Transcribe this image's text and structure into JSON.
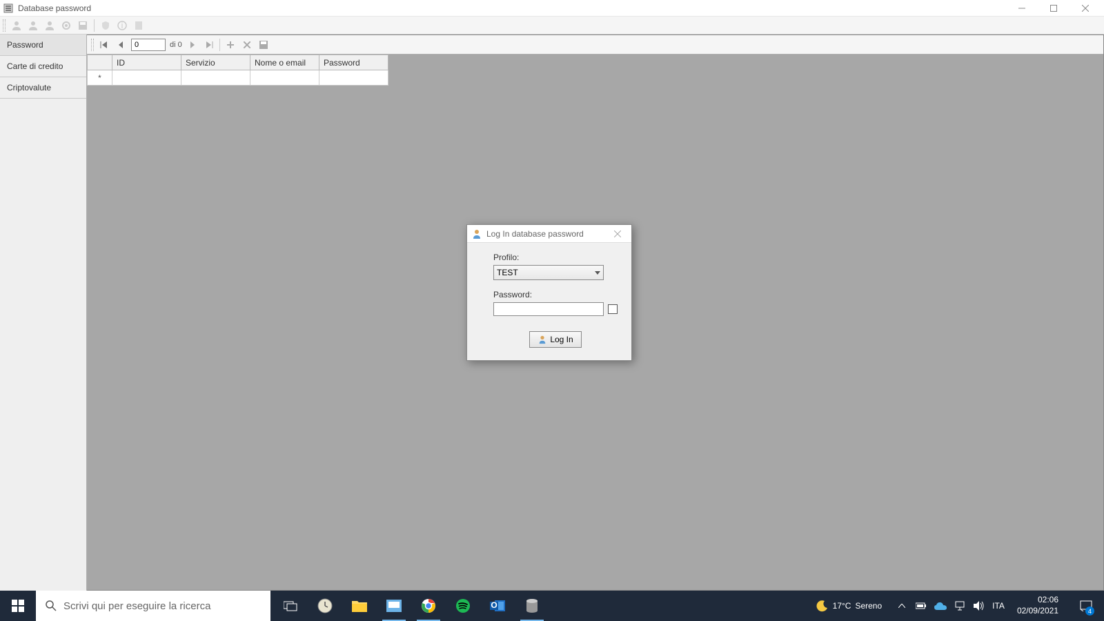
{
  "window": {
    "title": "Database password"
  },
  "sidebar": {
    "items": [
      {
        "label": "Password"
      },
      {
        "label": "Carte di credito"
      },
      {
        "label": "Criptovalute"
      }
    ]
  },
  "navigator": {
    "position": "0",
    "count_text": "di 0"
  },
  "grid": {
    "columns": [
      "ID",
      "Servizio",
      "Nome o email",
      "Password"
    ],
    "new_row_marker": "*"
  },
  "modal": {
    "title": "Log In database password",
    "profile_label": "Profilo:",
    "profile_value": "TEST",
    "password_label": "Password:",
    "password_value": "",
    "login_button": "Log In"
  },
  "taskbar": {
    "search_placeholder": "Scrivi qui per eseguire la ricerca",
    "weather_temp": "17°C",
    "weather_desc": "Sereno",
    "language": "ITA",
    "time": "02:06",
    "date": "02/09/2021",
    "notif_count": "4"
  }
}
